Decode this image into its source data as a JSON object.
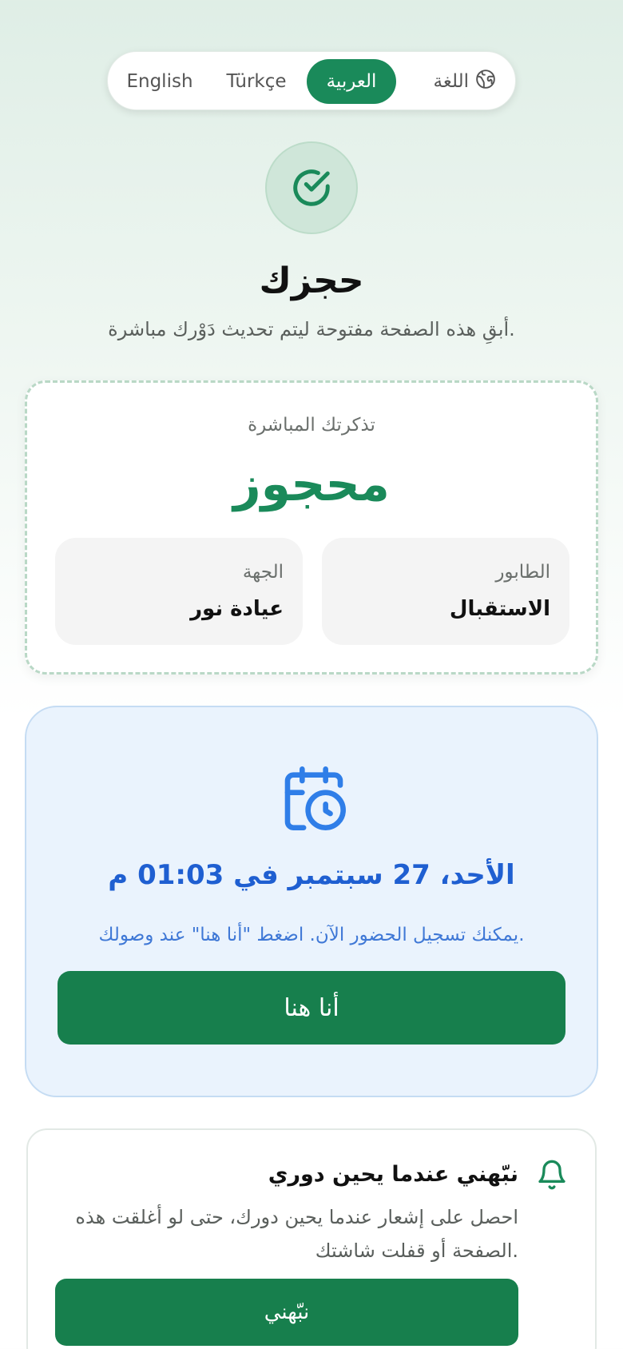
{
  "language": {
    "label": "اللغة",
    "icon": "globe-icon",
    "options": [
      "English",
      "Türkçe",
      "العربية"
    ],
    "selected": "العربية"
  },
  "header": {
    "status_icon": "check-circle-icon",
    "title": "حجزك",
    "subtitle": "أبقِ هذه الصفحة مفتوحة ليتم تحديث دَوْرك مباشرة."
  },
  "ticket": {
    "caption": "تذكرتك المباشرة",
    "status": "محجوز",
    "queue_label": "الطابور",
    "queue_value": "الاستقبال",
    "provider_label": "الجهة",
    "provider_value": "عيادة نور"
  },
  "appointment": {
    "icon": "calendar-clock-icon",
    "datetime": "الأحد، 27 سبتمبر في 01:03 م",
    "note": "يمكنك تسجيل الحضور الآن. اضغط \"أنا هنا\" عند وصولك.",
    "checkin_button": "أنا هنا"
  },
  "notify": {
    "icon": "bell-icon",
    "title": "نبّهني عندما يحين دوري",
    "description": "احصل على إشعار عندما يحين دورك، حتى لو أغلقت هذه الصفحة أو قفلت شاشتك.",
    "button": "نبّهني"
  },
  "colors": {
    "primary": "#177f4d",
    "accent_green": "#1a8a5a",
    "appointment_blue": "#1f5fd1",
    "appointment_bg": "#eaf3fd"
  }
}
